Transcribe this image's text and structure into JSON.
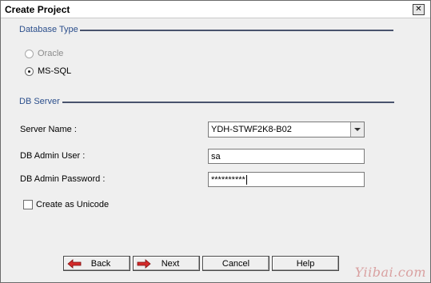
{
  "window": {
    "title": "Create Project",
    "close_glyph": "✕"
  },
  "database_type": {
    "label": "Database Type",
    "options": [
      {
        "label": "Oracle",
        "selected": false,
        "enabled": false
      },
      {
        "label": "MS-SQL",
        "selected": true,
        "enabled": true
      }
    ]
  },
  "db_server": {
    "label": "DB Server",
    "server_name": {
      "label": "Server Name :",
      "value": "YDH-STWF2K8-B02"
    },
    "admin_user": {
      "label": "DB Admin User :",
      "value": "sa"
    },
    "admin_password": {
      "label": "DB Admin Password :",
      "value": "**********"
    },
    "unicode": {
      "label": "Create as Unicode",
      "checked": false
    }
  },
  "buttons": {
    "back": "Back",
    "next": "Next",
    "cancel": "Cancel",
    "help": "Help"
  },
  "icons": {
    "back": "left-arrow-icon",
    "next": "right-arrow-icon",
    "arrow_color": "#d42a2a"
  },
  "watermark": "Yiibai.com"
}
